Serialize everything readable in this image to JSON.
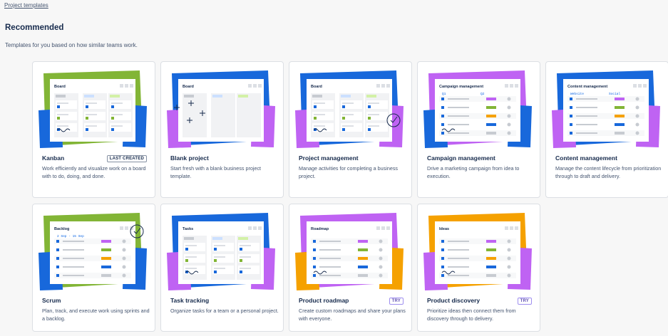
{
  "breadcrumb": "Project templates",
  "page": {
    "title": "Recommended",
    "subtitle": "Templates for you based on how similar teams work."
  },
  "cards": [
    {
      "id": "kanban",
      "title": "Kanban",
      "badge": "LAST CREATED",
      "badge_style": "grey",
      "art_label": "Board",
      "description": "Work efficiently and visualize work on a board with to do, doing, and done.",
      "colors": {
        "back": "#82b536",
        "front": "#1868db"
      }
    },
    {
      "id": "blank",
      "title": "Blank project",
      "badge": "",
      "art_label": "Board",
      "description": "Start fresh with a blank business project template.",
      "colors": {
        "back": "#1868db",
        "front": "#bf63f3"
      }
    },
    {
      "id": "project-management",
      "title": "Project management",
      "badge": "",
      "art_label": "Board",
      "description": "Manage activities for completing a business project.",
      "colors": {
        "back": "#1868db",
        "front": "#bf63f3"
      }
    },
    {
      "id": "campaign",
      "title": "Campaign management",
      "badge": "",
      "art_label": "Campaign management",
      "art_tags": [
        "Q1",
        "Q2"
      ],
      "description": "Drive a marketing campaign from idea to execution.",
      "colors": {
        "back": "#bf63f3",
        "front": "#1868db"
      }
    },
    {
      "id": "content",
      "title": "Content management",
      "badge": "",
      "art_label": "Content management",
      "art_tags": [
        "Website",
        "Social"
      ],
      "description": "Manage the content lifecycle from prioritization through to draft and delivery.",
      "colors": {
        "back": "#1868db",
        "front": "#bf63f3"
      }
    },
    {
      "id": "scrum",
      "title": "Scrum",
      "badge": "",
      "art_label": "Backlog",
      "art_tags": [
        "2 Sep - 15 Sep"
      ],
      "description": "Plan, track, and execute work using sprints and a backlog.",
      "colors": {
        "back": "#82b536",
        "front": "#1868db"
      }
    },
    {
      "id": "task-tracking",
      "title": "Task tracking",
      "badge": "",
      "art_label": "Tasks",
      "description": "Organize tasks for a team or a personal project.",
      "colors": {
        "back": "#1868db",
        "front": "#bf63f3"
      }
    },
    {
      "id": "product-roadmap",
      "title": "Product roadmap",
      "badge": "TRY",
      "badge_style": "try",
      "art_label": "Roadmap",
      "description": "Create custom roadmaps and share your plans with everyone.",
      "colors": {
        "back": "#bf63f3",
        "front": "#f5a100"
      }
    },
    {
      "id": "product-discovery",
      "title": "Product discovery",
      "badge": "TRY",
      "badge_style": "try",
      "art_label": "Ideas",
      "description": "Prioritize ideas then connect them from discovery through to delivery.",
      "colors": {
        "back": "#f5a100",
        "front": "#bf63f3"
      }
    }
  ]
}
